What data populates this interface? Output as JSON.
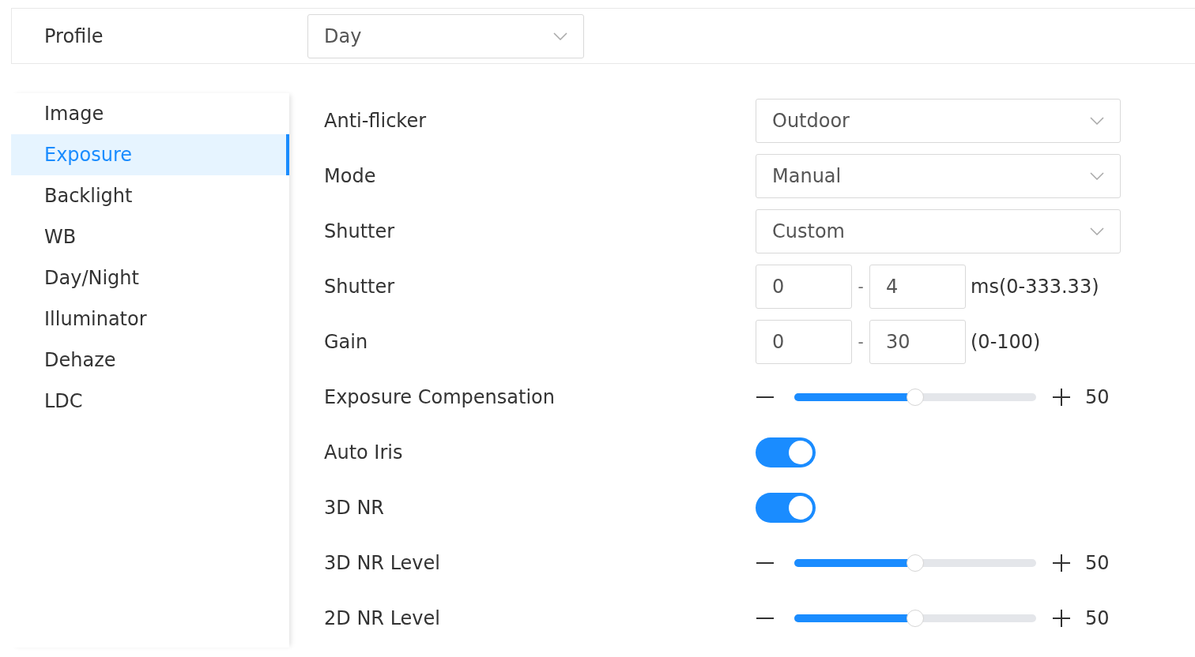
{
  "profile": {
    "label": "Profile",
    "value": "Day"
  },
  "sidebar": {
    "items": [
      {
        "label": "Image",
        "selected": false
      },
      {
        "label": "Exposure",
        "selected": true
      },
      {
        "label": "Backlight",
        "selected": false
      },
      {
        "label": "WB",
        "selected": false
      },
      {
        "label": "Day/Night",
        "selected": false
      },
      {
        "label": "Illuminator",
        "selected": false
      },
      {
        "label": "Dehaze",
        "selected": false
      },
      {
        "label": "LDC",
        "selected": false
      }
    ]
  },
  "settings": [
    {
      "kind": "select",
      "label": "Anti-flicker",
      "value": "Outdoor"
    },
    {
      "kind": "select",
      "label": "Mode",
      "value": "Manual"
    },
    {
      "kind": "select",
      "label": "Shutter",
      "value": "Custom"
    },
    {
      "kind": "range",
      "label": "Shutter",
      "min": "0",
      "separator": "-",
      "max": "4",
      "unit": "ms(0-333.33)"
    },
    {
      "kind": "range",
      "label": "Gain",
      "min": "0",
      "separator": "-",
      "max": "30",
      "unit": "(0-100)"
    },
    {
      "kind": "slider",
      "label": "Exposure Compensation",
      "level": 0.5,
      "value": "50"
    },
    {
      "kind": "toggle",
      "label": "Auto Iris",
      "on": true
    },
    {
      "kind": "toggle",
      "label": "3D NR",
      "on": true
    },
    {
      "kind": "slider",
      "label": "3D NR Level",
      "level": 0.5,
      "value": "50"
    },
    {
      "kind": "slider",
      "label": "2D NR Level",
      "level": 0.5,
      "value": "50"
    }
  ]
}
